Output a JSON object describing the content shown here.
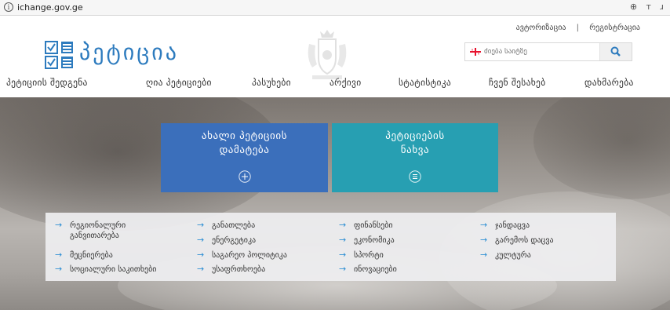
{
  "browser": {
    "info_icon": "info-icon",
    "url": "ichange.gov.ge",
    "tools": "⊕ ᴛ ɹ"
  },
  "header": {
    "logo_text": "პეტიცია",
    "auth": {
      "login": "ავტორიზაცია",
      "separator": "|",
      "register": "რეგისტრაცია"
    },
    "search": {
      "placeholder": "ძიება საიტზე",
      "button_icon": "search-icon"
    }
  },
  "nav": {
    "items": [
      "პეტიციის შედგენა",
      "ღია პეტიციები",
      "პასუხები",
      "არქივი",
      "სტატისტიკა",
      "ჩვენ შესახებ",
      "დახმარება"
    ]
  },
  "hero": {
    "tile_new": {
      "line1": "ახალი პეტიციის",
      "line2": "დამატება",
      "icon": "plus-circle-icon",
      "color": "#3b6fbb"
    },
    "tile_view": {
      "line1": "პეტიციების",
      "line2": "ნახვა",
      "icon": "list-circle-icon",
      "color": "#279fb2"
    }
  },
  "categories": {
    "columns": [
      [
        "რეგიონალური განვითარება",
        "მეცნიერება",
        "სოციალური საკითხები"
      ],
      [
        "განათლება",
        "ენერგეტიკა",
        "საგარეო პოლიტიკა",
        "უსაფრთხოება"
      ],
      [
        "ფინანსები",
        "ეკონომიკა",
        "სპორტი",
        "ინოვაციები"
      ],
      [
        "ჯანდაცვა",
        "გარემოს დაცვა",
        "კულტურა"
      ]
    ],
    "arrow": "→"
  },
  "colors": {
    "brand_blue": "#2d7bbe",
    "accent_cyan": "#279fb2",
    "arrow_blue": "#2f8fd4"
  }
}
